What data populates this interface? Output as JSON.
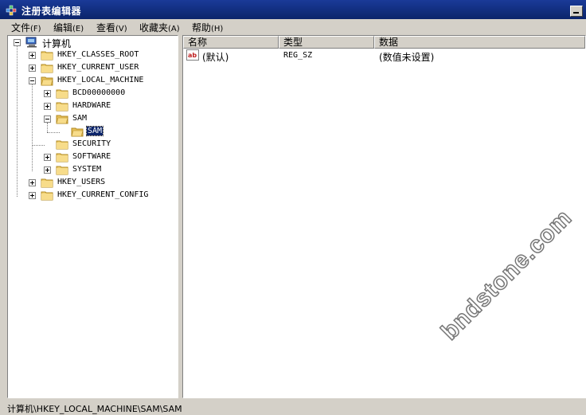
{
  "window": {
    "title": "注册表编辑器",
    "icon": "regedit-icon"
  },
  "menu": [
    {
      "label": "文件",
      "key": "(F)"
    },
    {
      "label": "编辑",
      "key": "(E)"
    },
    {
      "label": "查看",
      "key": "(V)"
    },
    {
      "label": "收藏夹",
      "key": "(A)"
    },
    {
      "label": "帮助",
      "key": "(H)"
    }
  ],
  "tree": {
    "root": "计算机",
    "nodes": [
      {
        "label": "HKEY_CLASSES_ROOT",
        "expander": "plus"
      },
      {
        "label": "HKEY_CURRENT_USER",
        "expander": "plus"
      },
      {
        "label": "HKEY_LOCAL_MACHINE",
        "expander": "minus"
      },
      {
        "label": "BCD00000000",
        "expander": "plus"
      },
      {
        "label": "HARDWARE",
        "expander": "plus"
      },
      {
        "label": "SAM",
        "expander": "minus"
      },
      {
        "label": "SAM",
        "expander": "none",
        "selected": true
      },
      {
        "label": "SECURITY",
        "expander": "none"
      },
      {
        "label": "SOFTWARE",
        "expander": "plus"
      },
      {
        "label": "SYSTEM",
        "expander": "plus"
      },
      {
        "label": "HKEY_USERS",
        "expander": "plus"
      },
      {
        "label": "HKEY_CURRENT_CONFIG",
        "expander": "plus"
      }
    ]
  },
  "list": {
    "columns": [
      "名称",
      "类型",
      "数据"
    ],
    "rows": [
      {
        "name": "(默认)",
        "type": "REG_SZ",
        "data": "(数值未设置)",
        "icon": "string-value-icon"
      }
    ]
  },
  "status": "计算机\\HKEY_LOCAL_MACHINE\\SAM\\SAM",
  "watermark": "bndstone.com",
  "colors": {
    "titlebar": "#0a246a",
    "selection": "#0a246a",
    "folder": "#e8c15a",
    "chrome": "#d4d0c8"
  }
}
